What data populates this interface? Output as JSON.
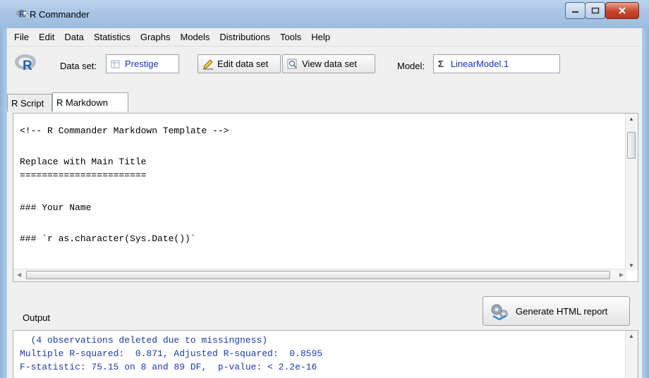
{
  "window": {
    "title": "R Commander"
  },
  "menu": [
    "File",
    "Edit",
    "Data",
    "Statistics",
    "Graphs",
    "Models",
    "Distributions",
    "Tools",
    "Help"
  ],
  "toolbar": {
    "dataset_label": "Data set:",
    "dataset_value": "Prestige",
    "edit_button": "Edit data set",
    "view_button": "View data set",
    "model_label": "Model:",
    "model_value": "LinearModel.1"
  },
  "tabs": [
    {
      "label": "R Script",
      "active": false
    },
    {
      "label": "R Markdown",
      "active": true
    }
  ],
  "editor": {
    "lines": [
      "<!-- R Commander Markdown Template -->",
      "",
      "Replace with Main Title",
      "=======================",
      "",
      "### Your Name",
      "",
      "### `r as.character(Sys.Date())`"
    ]
  },
  "output": {
    "label": "Output",
    "generate_button": "Generate HTML report",
    "lines": [
      "  (4 observations deleted due to missingness)",
      "Multiple R-squared:  0.871, Adjusted R-squared:  0.8595",
      "F-statistic: 75.15 on 8 and 89 DF,  p-value: < 2.2e-16"
    ]
  },
  "colors": {
    "accent_text": "#1034c8",
    "output_text": "#1d3bb0",
    "titlebar": "#a9c5e5"
  }
}
